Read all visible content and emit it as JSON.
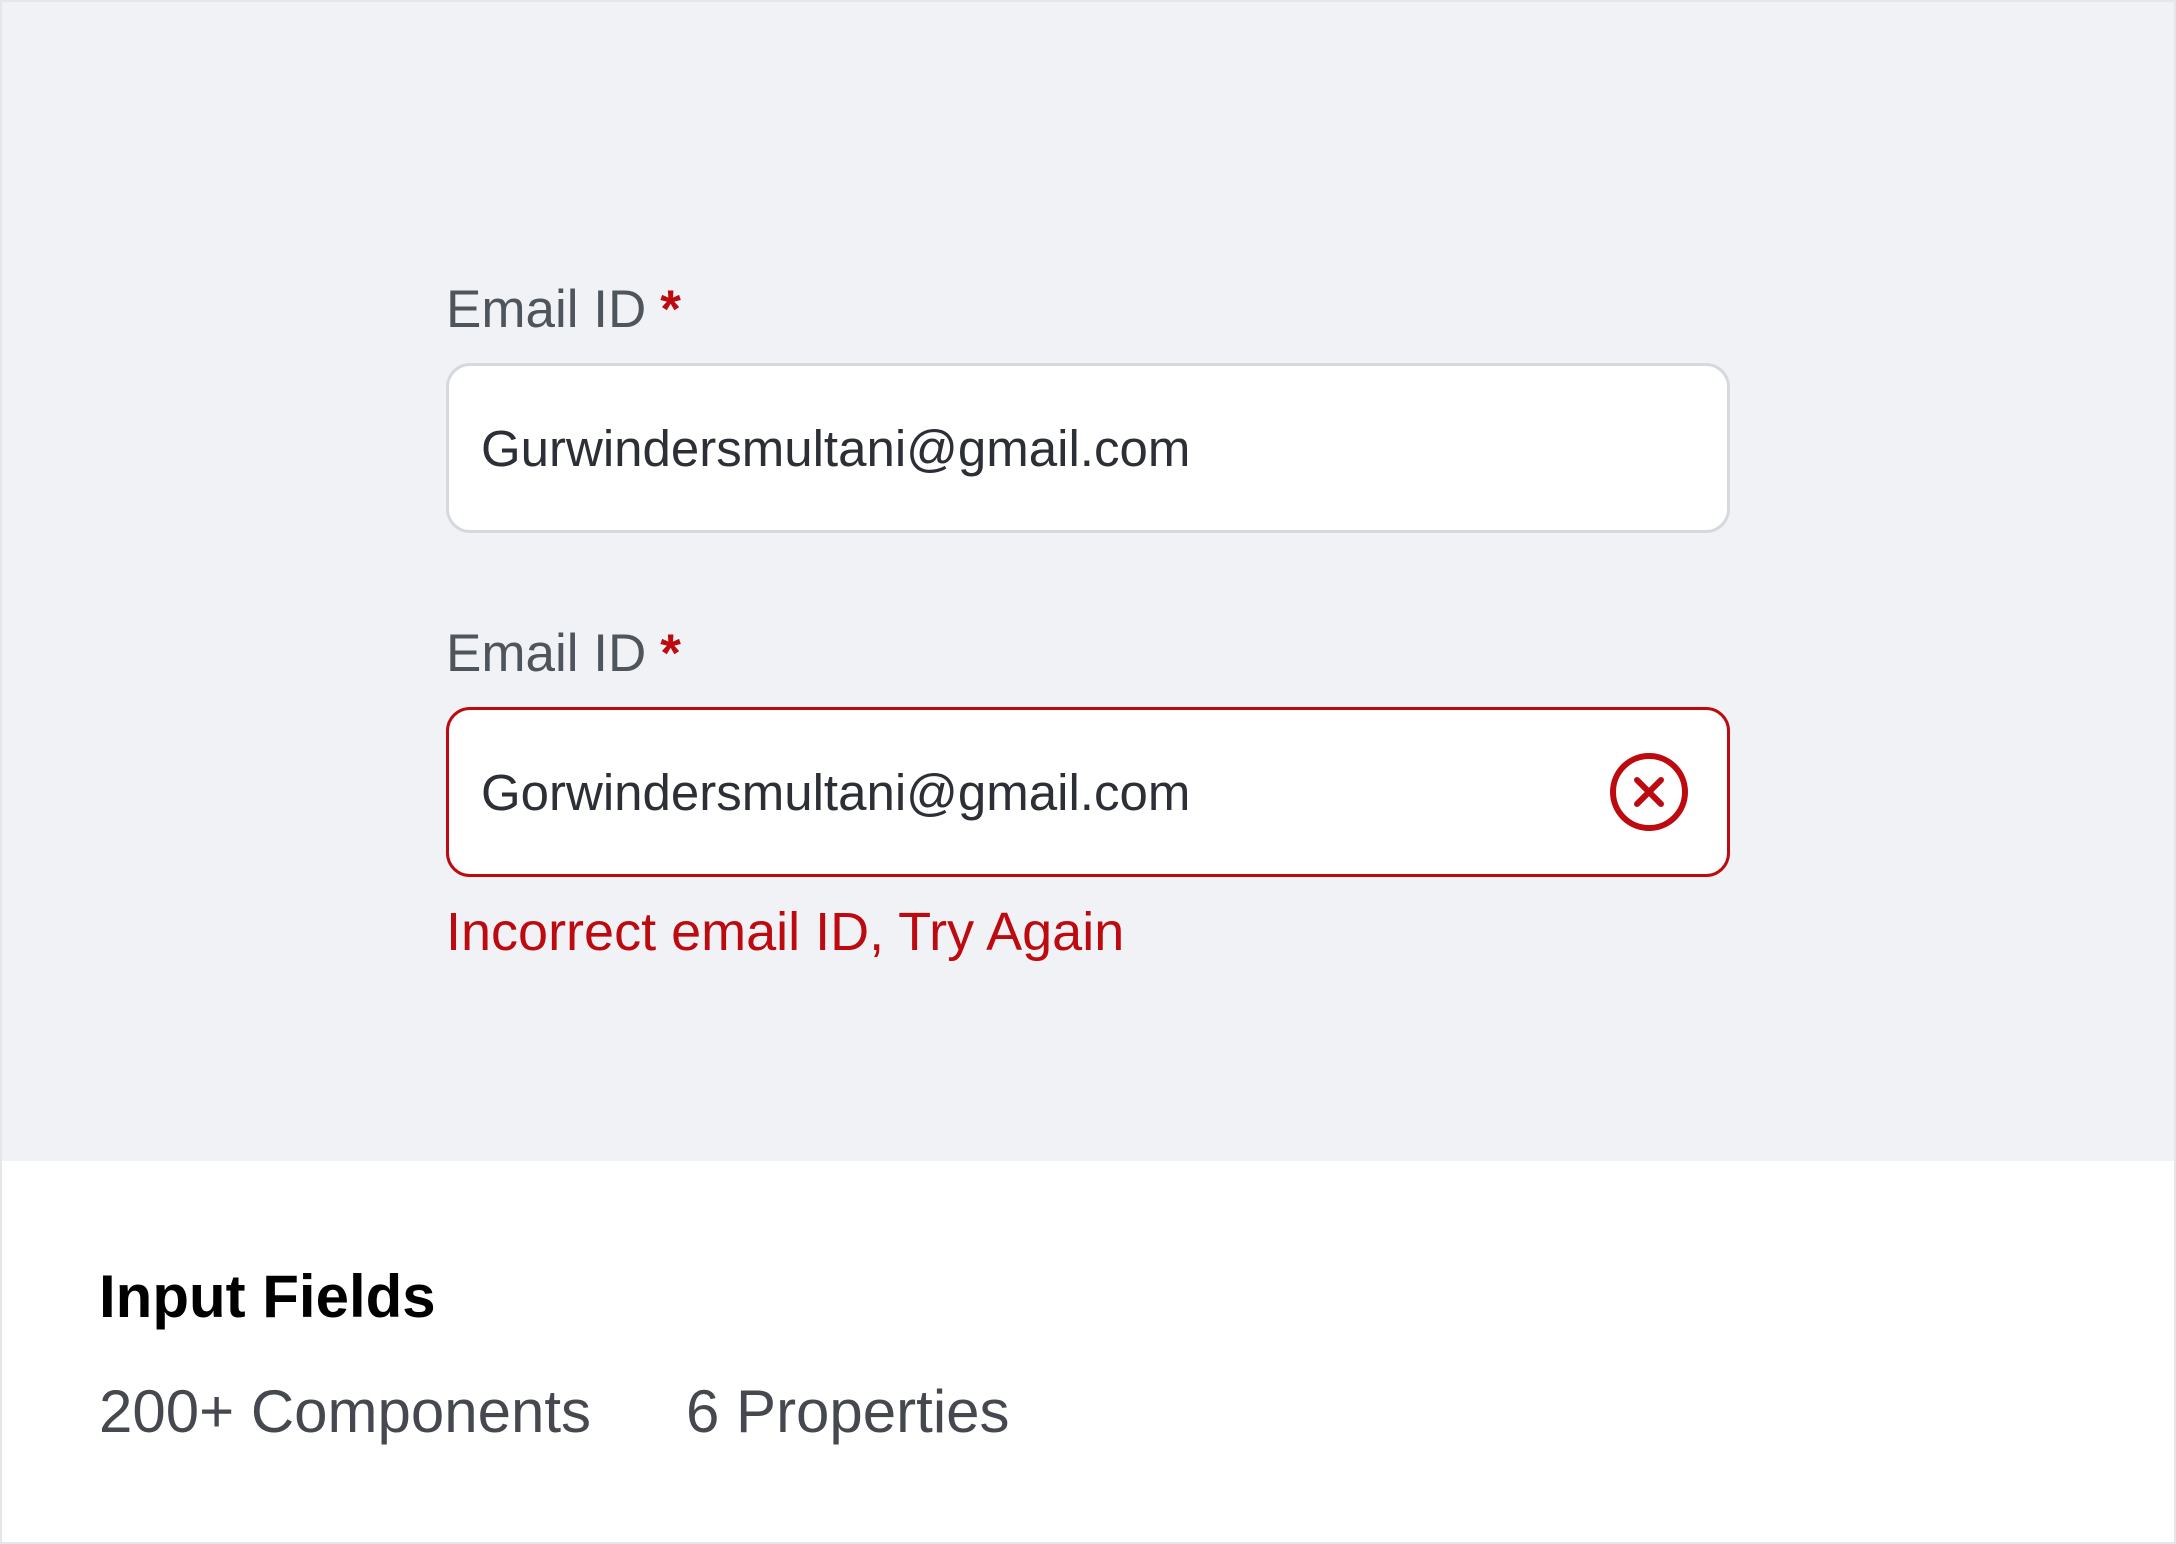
{
  "form": {
    "fields": [
      {
        "label": "Email ID",
        "required_mark": "*",
        "value": "Gurwindersmultani@gmail.com",
        "state": "default"
      },
      {
        "label": "Email ID",
        "required_mark": "*",
        "value": "Gorwindersmultani@gmail.com",
        "state": "error",
        "icon": "error-clear-icon",
        "error_message": "Incorrect email ID, Try Again"
      }
    ]
  },
  "footer": {
    "title": "Input Fields",
    "components": "200+ Components",
    "properties": "6 Properties"
  },
  "colors": {
    "preview_background": "#f0f2f5",
    "error": "#bd0a10",
    "default_border": "#d5d8de",
    "label_text": "#4f555c",
    "value_text": "#2c3036"
  }
}
